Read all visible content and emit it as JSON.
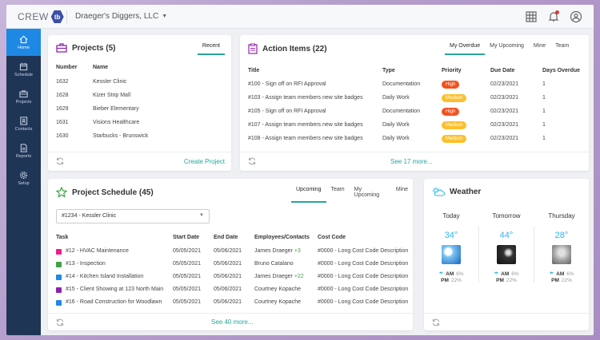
{
  "app": {
    "logo_text": "CREW",
    "logo_badge": "tb",
    "company": "Draeger's Diggers, LLC"
  },
  "sidebar": {
    "items": [
      {
        "label": "Home",
        "icon": "home-icon"
      },
      {
        "label": "Schedule",
        "icon": "calendar-icon"
      },
      {
        "label": "Projects",
        "icon": "briefcase-icon"
      },
      {
        "label": "Contacts",
        "icon": "contacts-icon"
      },
      {
        "label": "Reports",
        "icon": "report-icon"
      },
      {
        "label": "Setup",
        "icon": "gear-icon"
      }
    ]
  },
  "projects": {
    "title": "Projects (5)",
    "tab": "Recent",
    "columns": [
      "Number",
      "Name"
    ],
    "rows": [
      [
        "1632",
        "Kessler Clinic"
      ],
      [
        "1628",
        "Kizer Strip Mall"
      ],
      [
        "1629",
        "Bieber Elementary"
      ],
      [
        "1631",
        "Visions Healthcare"
      ],
      [
        "1630",
        "Starbucks - Brunswick"
      ]
    ],
    "footer_link": "Create Project"
  },
  "actions": {
    "title": "Action Items (22)",
    "tabs": [
      "My Overdue",
      "My Upcoming",
      "Mine",
      "Team"
    ],
    "columns": [
      "Title",
      "Type",
      "Priority",
      "Due Date",
      "Days Overdue"
    ],
    "rows": [
      [
        "#100 - Sign off on RFI Approval",
        "Documentation",
        "High",
        "02/23/2021",
        "1"
      ],
      [
        "#103 - Assign team members new site badges",
        "Daily Work",
        "Medium",
        "02/23/2021",
        "1"
      ],
      [
        "#105 - Sign off on RFI Approval",
        "Documentation",
        "High",
        "02/23/2021",
        "1"
      ],
      [
        "#107 - Assign team members new site badges",
        "Daily Work",
        "Medium",
        "02/23/2021",
        "1"
      ],
      [
        "#108 - Assign team members new site badges",
        "Daily Work",
        "Medium",
        "02/23/2021",
        "1"
      ]
    ],
    "footer_link": "See 17 more..."
  },
  "schedule": {
    "title": "Project Schedule (45)",
    "tabs": [
      "Upcoming",
      "Team",
      "My Upcoming",
      "Mine"
    ],
    "select_value": "#1234 - Kessler Clinic",
    "columns": [
      "Task",
      "Start Date",
      "End Date",
      "Employees/Contacts",
      "Cost Code"
    ],
    "rows": [
      {
        "color": "#e91e8c",
        "task": "#12 - HVAC Maintenance",
        "start": "05/05/2021",
        "end": "05/06/2021",
        "emp": "James Draeger",
        "extra": "+3",
        "code": "#0000 - Long Cost Code Description"
      },
      {
        "color": "#43a047",
        "task": "#13 - Inspection",
        "start": "05/05/2021",
        "end": "05/06/2021",
        "emp": "Bruno Catalano",
        "extra": "",
        "code": "#0000 - Long Cost Code Description"
      },
      {
        "color": "#1e88e5",
        "task": "#14 - Kitchen Island Installation",
        "start": "05/05/2021",
        "end": "05/06/2021",
        "emp": "James Draeger",
        "extra": "+22",
        "code": "#0000 - Long Cost Code Description"
      },
      {
        "color": "#8e24aa",
        "task": "#15 - Client Showing at 123 North Main",
        "start": "05/05/2021",
        "end": "05/06/2021",
        "emp": "Courtney Kopache",
        "extra": "",
        "code": "#0000 - Long Cost Code Description"
      },
      {
        "color": "#1e88e5",
        "task": "#16 - Road Construction for Woodlawn",
        "start": "05/05/2021",
        "end": "05/06/2021",
        "emp": "Courtney Kopache",
        "extra": "",
        "code": "#0000 - Long Cost Code Description"
      }
    ],
    "footer_link": "See 40 more..."
  },
  "weather": {
    "title": "Weather",
    "days": [
      {
        "day": "Today",
        "temp": "34°",
        "am_label": "AM",
        "am": "6%",
        "pm_label": "PM",
        "pm": "22%",
        "kind": "sunny"
      },
      {
        "day": "Tomorrow",
        "temp": "44°",
        "am_label": "AM",
        "am": "6%",
        "pm_label": "PM",
        "pm": "22%",
        "kind": "night"
      },
      {
        "day": "Thursday",
        "temp": "28°",
        "am_label": "AM",
        "am": "6%",
        "pm_label": "PM",
        "pm": "22%",
        "kind": "cloudy"
      }
    ]
  },
  "colors": {
    "accent": "#26a69a",
    "sidebar": "#1f3556",
    "sidebar_active": "#1e88e5",
    "high": "#f4511e",
    "medium": "#fbc02d"
  }
}
